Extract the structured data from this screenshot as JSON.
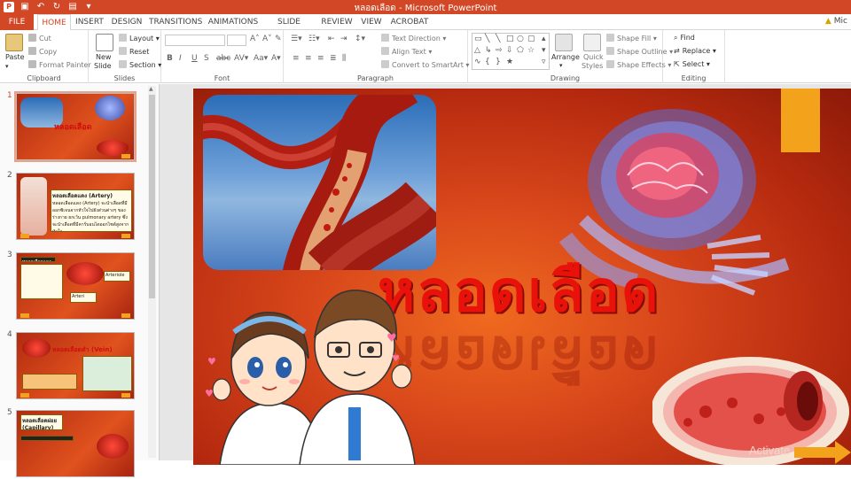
{
  "window": {
    "title": "หลอดเลือด - Microsoft PowerPoint",
    "account": "Mic"
  },
  "tabs": [
    "FILE",
    "HOME",
    "INSERT",
    "DESIGN",
    "TRANSITIONS",
    "ANIMATIONS",
    "SLIDE SHOW",
    "REVIEW",
    "VIEW",
    "ACROBAT"
  ],
  "active_tab": "HOME",
  "ribbon": {
    "clipboard": {
      "label": "Clipboard",
      "paste": "Paste",
      "cut": "Cut",
      "copy": "Copy",
      "format_painter": "Format Painter"
    },
    "slides": {
      "label": "Slides",
      "new_slide": "New",
      "new_slide2": "Slide",
      "layout": "Layout",
      "reset": "Reset",
      "section": "Section"
    },
    "font": {
      "label": "Font"
    },
    "paragraph": {
      "label": "Paragraph",
      "text_direction": "Text Direction",
      "align_text": "Align Text",
      "convert_smartart": "Convert to SmartArt"
    },
    "drawing": {
      "label": "Drawing",
      "arrange": "Arrange",
      "quick_styles": "Quick",
      "quick_styles2": "Styles",
      "shape_fill": "Shape Fill",
      "shape_outline": "Shape Outline",
      "shape_effects": "Shape Effects"
    },
    "editing": {
      "label": "Editing",
      "find": "Find",
      "replace": "Replace",
      "select": "Select"
    }
  },
  "thumbnails": [
    {
      "num": "1",
      "title": "หลอดเลือด"
    },
    {
      "num": "2",
      "title": "หลอดเลือดแดง (Artery)",
      "text": "หลอดเลือดแดง (Artery) จะนำเลือดที่มีออกซิเจนจากหัวใจไปยังส่วนต่างๆ ของร่างกาย ยกเว้น pulmonary artery ซึ่งจะนำเลือดที่มีคาร์บอนไดออกไซด์สูงจากหัวใจ"
    },
    {
      "num": "3",
      "title": "Arteriole",
      "label1": "หลอดเลือดแดงเล็ก",
      "label2": "Arteriole",
      "label3": "Arteri"
    },
    {
      "num": "4",
      "title": "หลอดเลือดดำ (Vein)"
    },
    {
      "num": "5",
      "title": "หลอดเลือดฝอย (Capillary)"
    }
  ],
  "slide": {
    "title": "หลอดเลือด",
    "watermark": "Activate"
  },
  "colors": {
    "accent": "#d24726",
    "title_red": "#e8120b",
    "orange_bar": "#f3a21b"
  }
}
